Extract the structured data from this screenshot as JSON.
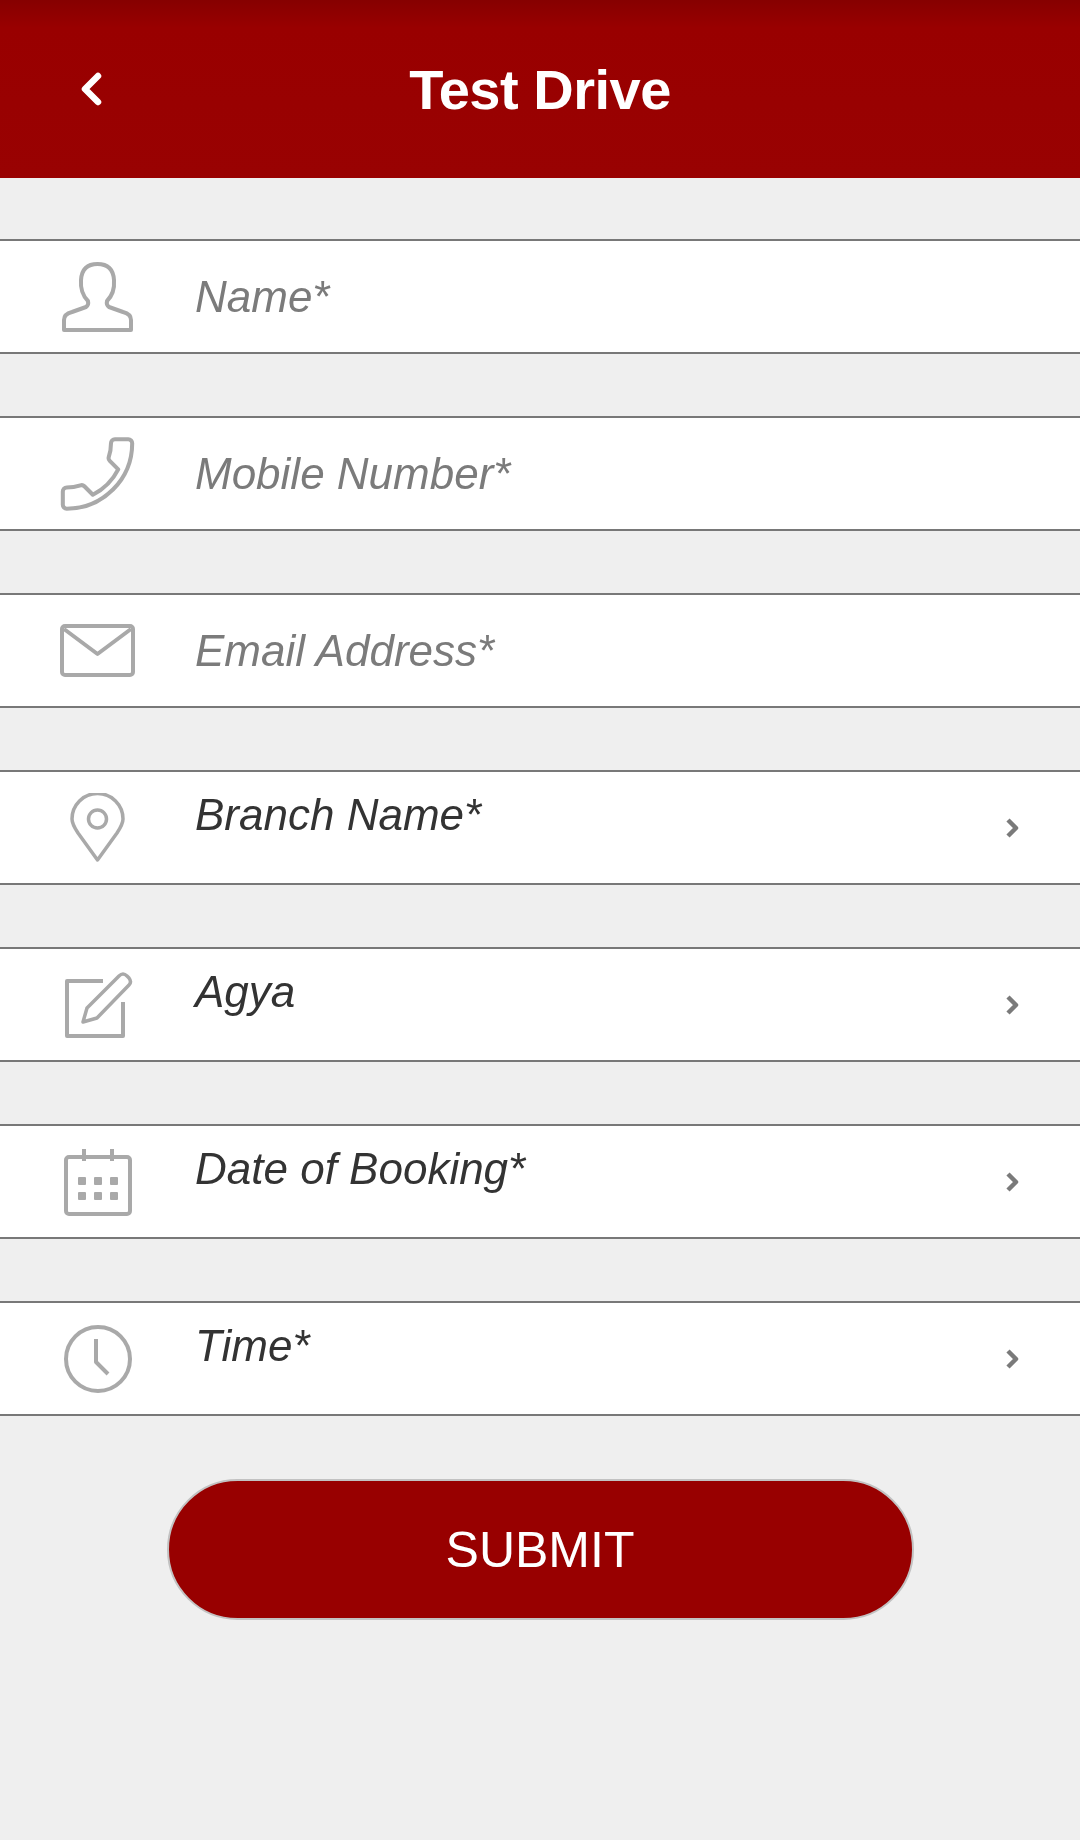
{
  "header": {
    "title": "Test Drive"
  },
  "fields": [
    {
      "kind": "input",
      "placeholder": "Name*"
    },
    {
      "kind": "input",
      "placeholder": "Mobile Number*"
    },
    {
      "kind": "input",
      "placeholder": "Email Address*"
    },
    {
      "kind": "picker",
      "text": "Branch Name*"
    },
    {
      "kind": "picker",
      "text": "Agya"
    },
    {
      "kind": "picker",
      "text": "Date of Booking*"
    },
    {
      "kind": "picker",
      "text": "Time*"
    }
  ],
  "submit_button": {
    "label": "SUBMIT"
  }
}
